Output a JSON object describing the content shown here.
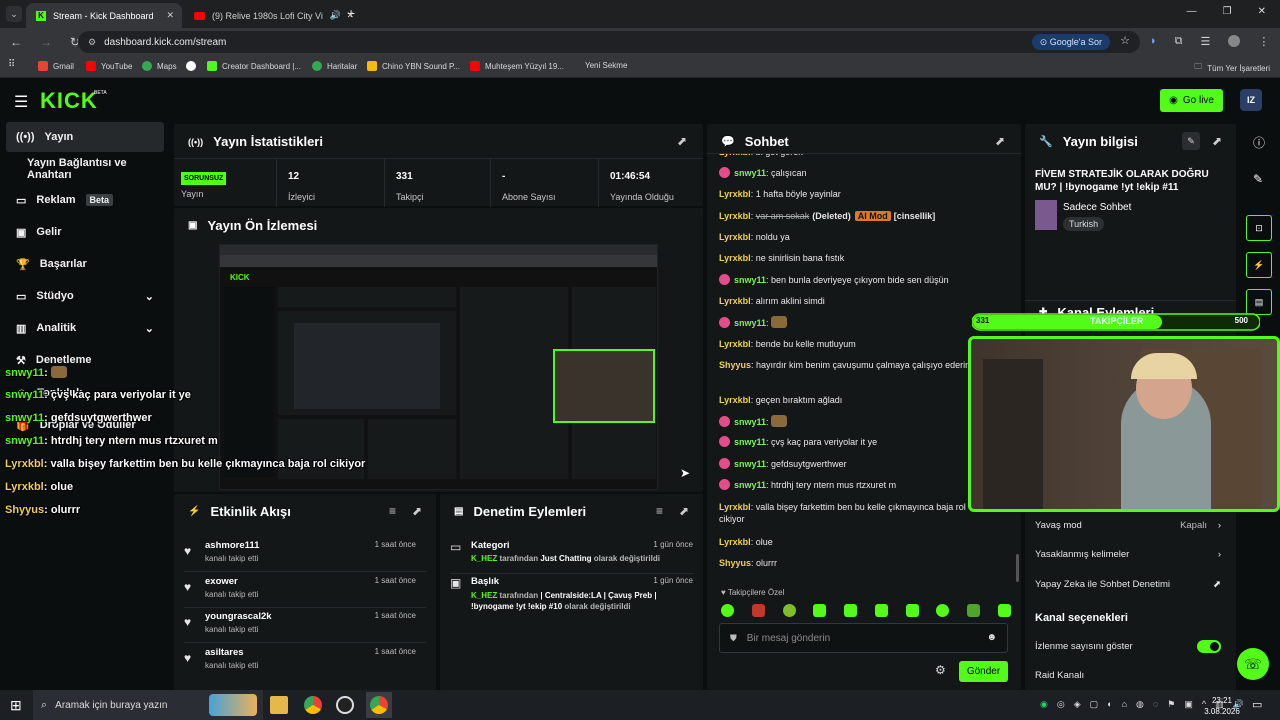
{
  "browser": {
    "tabs": [
      {
        "title": "Stream - Kick Dashboard"
      },
      {
        "title": "(9) Relive 1980s Lofi City Vi"
      }
    ],
    "url": "dashboard.kick.com/stream",
    "google_btn": "Google'a Sor",
    "bookmarks": [
      "Gmail",
      "YouTube",
      "Maps",
      "Creator Dashboard |...",
      "Haritalar",
      "Chino YBN Sound P...",
      "Muhteşem Yüzyıl 19...",
      "Yeni Sekme"
    ],
    "all_bookmarks": "Tüm Yer İşaretleri"
  },
  "kick": {
    "logo": "KICK",
    "beta": "BETA",
    "go_live": "Go live",
    "avatar": "IZ"
  },
  "sidebar": {
    "items": [
      {
        "label": "Yayın"
      },
      {
        "label": "Yayın Bağlantısı ve Anahtarı"
      },
      {
        "label": "Reklam",
        "badge": "Beta"
      },
      {
        "label": "Gelir"
      },
      {
        "label": "Başarılar"
      },
      {
        "label": "Stüdyo"
      },
      {
        "label": "Analitik"
      },
      {
        "label": "Denetleme"
      },
      {
        "label": "Topluluk"
      },
      {
        "label": "Droplar ve Ödüller"
      }
    ]
  },
  "stats": {
    "title": "Yayın İstatistikleri",
    "status_badge": "SORUNSUZ",
    "status_label": "Yayın",
    "items": [
      {
        "value": "12",
        "label": "İzleyici"
      },
      {
        "value": "331",
        "label": "Takipçi"
      },
      {
        "value": "-",
        "label": "Abone Sayısı"
      },
      {
        "value": "01:46:54",
        "label": "Yayında Olduğu"
      }
    ]
  },
  "preview": {
    "title": "Yayın Ön İzlemesi"
  },
  "activity": {
    "title": "Etkinlik Akışı",
    "items": [
      {
        "name": "ashmore111",
        "sub": "kanalı takip etti",
        "time": "1 saat önce"
      },
      {
        "name": "exower",
        "sub": "kanalı takip etti",
        "time": "1 saat önce"
      },
      {
        "name": "youngrascal2k",
        "sub": "kanalı takip etti",
        "time": "1 saat önce"
      },
      {
        "name": "asiltares",
        "sub": "kanalı takip etti",
        "time": "1 saat önce"
      }
    ]
  },
  "moderation": {
    "title": "Denetim Eylemleri",
    "items": [
      {
        "title": "Kategori",
        "user": "K_HEZ",
        "mid": " tarafından ",
        "value": "Just Chatting",
        "tail": " olarak değiştirildi",
        "time": "1 gün önce"
      },
      {
        "title": "Başlık",
        "user": "K_HEZ",
        "mid": " tarafından ",
        "value": "| Centralside:LA | Çavuş Preb | !bynogame !yt !ekip #10",
        "tail": " olarak değiştirildi",
        "time": "1 gün önce"
      }
    ]
  },
  "chat": {
    "title": "Sohbet",
    "messages": [
      {
        "user": "Lyrxkbl",
        "color": "y",
        "text": "bi göt görek"
      },
      {
        "user": "snwy11",
        "color": "pk",
        "text": "çalışıcan"
      },
      {
        "user": "Lyrxkbl",
        "color": "y",
        "text": "1 hafta böyle yayinlar"
      },
      {
        "user": "Lyrxkbl",
        "color": "y",
        "text": "var am sokak",
        "deleted": "(Deleted)",
        "tag": "AI Mod",
        "extra": "[cinsellik]"
      },
      {
        "user": "Lyrxkbl",
        "color": "y",
        "text": "noldu ya"
      },
      {
        "user": "Lyrxkbl",
        "color": "y",
        "text": "ne sinirlisin bana fıstık"
      },
      {
        "user": "snwy11",
        "color": "pk",
        "text": "ben bunla devriyeye çıkıyom bide sen düşün"
      },
      {
        "user": "Lyrxkbl",
        "color": "y",
        "text": "alırım aklini simdi"
      },
      {
        "user": "snwy11",
        "color": "pk",
        "text": ""
      },
      {
        "user": "Lyrxkbl",
        "color": "y",
        "text": "bende bu kelle mutluyum"
      },
      {
        "user": "Shyyus",
        "color": "y",
        "text": "hayırdır kim benim çavuşumu çalmaya çalışıyo ederim he"
      },
      {
        "user": "Lyrxkbl",
        "color": "y",
        "text": "geçen bıraktım ağladı"
      },
      {
        "user": "snwy11",
        "color": "pk",
        "text": ""
      },
      {
        "user": "snwy11",
        "color": "pk",
        "text": "çvş kaç para veriyolar it ye"
      },
      {
        "user": "snwy11",
        "color": "pk",
        "text": "gefdsuytgwerthwer"
      },
      {
        "user": "snwy11",
        "color": "pk",
        "text": "htrdhj tery ntern mus rtzxuret m"
      },
      {
        "user": "Lyrxkbl",
        "color": "y",
        "text": "valla bişey farkettim ben bu kelle çıkmayınca baja rol cikiyor"
      },
      {
        "user": "Lyrxkbl",
        "color": "y",
        "text": "olue"
      },
      {
        "user": "Shyyus",
        "color": "y",
        "text": "olurrr"
      }
    ],
    "followers_only": "Takipçilere Özel",
    "input_placeholder": "Bir mesaj gönderin",
    "send": "Gönder"
  },
  "info": {
    "title": "Yayın bilgisi",
    "stream_title": "FİVEM STRATEJİK OLARAK DOĞRU MU? | !bynogame !yt !ekip #11",
    "category": "Sadece Sohbet",
    "language": "Turkish",
    "actions_title": "Kanal Eylemleri",
    "settings": [
      {
        "label": "Yavaş mod",
        "value": "Kapalı"
      },
      {
        "label": "Yasaklanmış kelimeler",
        "value": ""
      },
      {
        "label": "Yapay Zeka ile Sohbet Denetimi",
        "value": ""
      }
    ],
    "channel_options": "Kanal seçenekleri",
    "show_viewers": "İzlenme sayısını göster",
    "raid": "Raid Kanalı"
  },
  "overlay": {
    "goal_current": "331",
    "goal_label": "TAKİPÇİLER",
    "goal_target": "500",
    "goal_progress": 0.662,
    "chat": [
      {
        "user": "snwy11",
        "color": "g",
        "text": ""
      },
      {
        "user": "snwy11",
        "color": "g",
        "text": "çvş kaç para veriyolar it ye"
      },
      {
        "user": "snwy11",
        "color": "g",
        "text": "gefdsuytgwerthwer"
      },
      {
        "user": "snwy11",
        "color": "g",
        "text": "htrdhj tery ntern mus rtzxuret m"
      },
      {
        "user": "Lyrxkbl",
        "color": "y",
        "text": "valla bişey farkettim ben bu kelle çıkmayınca baja rol cikiyor"
      },
      {
        "user": "Lyrxkbl",
        "color": "y",
        "text": "olue"
      },
      {
        "user": "Shyyus",
        "color": "y",
        "text": "olurrr"
      }
    ]
  },
  "taskbar": {
    "search": "Aramak için buraya yazın",
    "time": "23:21",
    "date": "3.08.2026"
  }
}
